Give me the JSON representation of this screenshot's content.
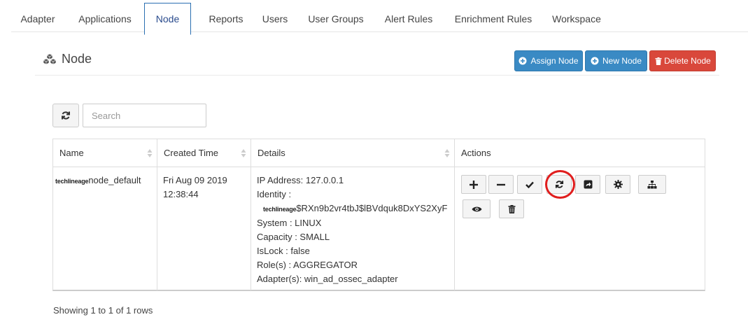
{
  "nav": {
    "tabs": [
      {
        "label": "Adapter"
      },
      {
        "label": "Applications"
      },
      {
        "label": "Node"
      },
      {
        "label": "Reports"
      },
      {
        "label": "Users"
      },
      {
        "label": "User Groups"
      },
      {
        "label": "Alert Rules"
      },
      {
        "label": "Enrichment Rules"
      },
      {
        "label": "Workspace"
      }
    ],
    "active": "Node"
  },
  "header": {
    "title": "Node",
    "assign_label": "Assign Node",
    "new_label": "New Node",
    "delete_label": "Delete Node"
  },
  "toolbar": {
    "search_placeholder": "Search"
  },
  "table": {
    "columns": [
      "Name",
      "Created Time",
      "Details",
      "Actions"
    ],
    "rows": [
      {
        "name_prefix": "techlineage",
        "name": "node_default",
        "created_line1": "Fri Aug 09 2019",
        "created_line2": "12:38:44",
        "ip": "IP Address: 127.0.0.1",
        "identity_label": "Identity :",
        "identity_prefix": "techlineage",
        "identity_value": "$RXn9b2vr4tbJ$lBVdquk8DxYS2XyF",
        "system": "System : LINUX",
        "capacity": "Capacity : SMALL",
        "islock": "IsLock : false",
        "roles": "Role(s) : AGGREGATOR",
        "adapters": "Adapter(s): win_ad_ossec_adapter"
      }
    ]
  },
  "footer": {
    "showing": "Showing 1 to 1 of 1 rows"
  },
  "colors": {
    "primary": "#3a8ac4",
    "danger": "#d9483b",
    "highlight_circle": "#e01e1e",
    "active_tab_border": "#2a6fb1"
  }
}
